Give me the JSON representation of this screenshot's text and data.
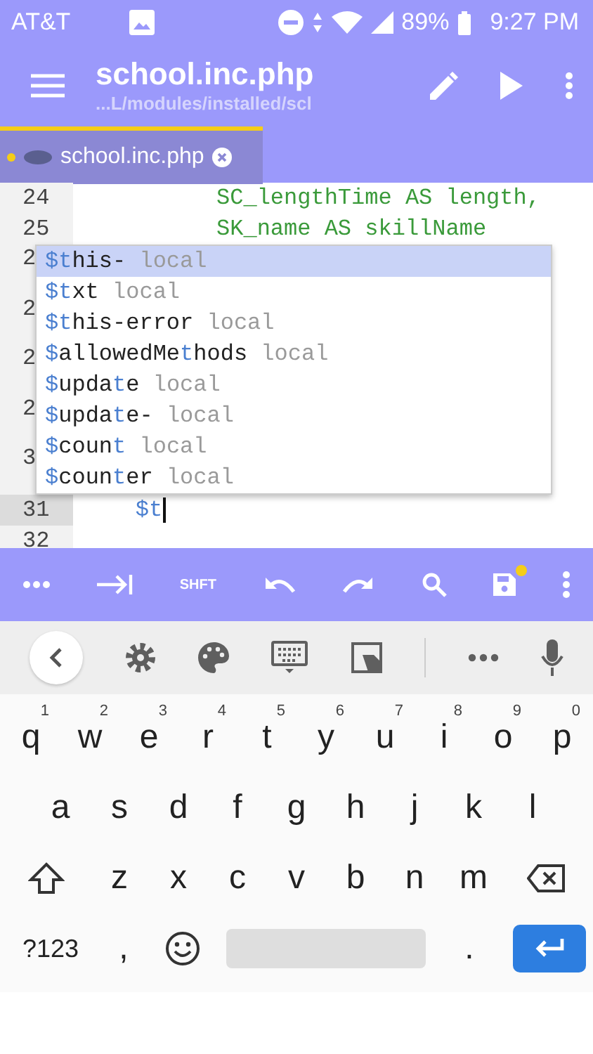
{
  "status_bar": {
    "carrier": "AT&T",
    "battery": "89%",
    "time": "9:27 PM"
  },
  "app_bar": {
    "title": "school.inc.php",
    "subtitle": "...L/modules/installed/scl"
  },
  "tabs": [
    {
      "label": "school.inc.php",
      "selected": true,
      "modified": true
    }
  ],
  "editor": {
    "lines": [
      {
        "kind": "line",
        "number": "24",
        "code": "          SC_lengthTime AS length,",
        "current": false
      },
      {
        "kind": "line",
        "number": "25",
        "code": "          SK_name AS skillName",
        "current": false
      },
      {
        "kind": "covered",
        "number": "2",
        "current": false
      },
      {
        "kind": "covered",
        "number": "2",
        "current": false
      },
      {
        "kind": "covered",
        "number": "2",
        "current": false
      },
      {
        "kind": "covered",
        "number": "2",
        "current": false
      },
      {
        "kind": "covered",
        "number": "3",
        "current": false
      },
      {
        "kind": "line",
        "number": "31",
        "code": "    $t",
        "current": true
      },
      {
        "kind": "line",
        "number": "32",
        "current": false
      }
    ],
    "completions": [
      {
        "selected": true,
        "parts": [
          {
            "text": "$t",
            "match": true
          },
          {
            "text": "his-",
            "match": false
          }
        ],
        "type": "local"
      },
      {
        "selected": false,
        "parts": [
          {
            "text": "$t",
            "match": true
          },
          {
            "text": "xt",
            "match": false
          }
        ],
        "type": "local"
      },
      {
        "selected": false,
        "parts": [
          {
            "text": "$t",
            "match": true
          },
          {
            "text": "his-error",
            "match": false
          }
        ],
        "type": "local"
      },
      {
        "selected": false,
        "parts": [
          {
            "text": "$",
            "match": true
          },
          {
            "text": "allowedMe",
            "match": false
          },
          {
            "text": "t",
            "match": true
          },
          {
            "text": "hods",
            "match": false
          }
        ],
        "type": "local"
      },
      {
        "selected": false,
        "parts": [
          {
            "text": "$",
            "match": true
          },
          {
            "text": "upda",
            "match": false
          },
          {
            "text": "t",
            "match": true
          },
          {
            "text": "e",
            "match": false
          }
        ],
        "type": "local"
      },
      {
        "selected": false,
        "parts": [
          {
            "text": "$",
            "match": true
          },
          {
            "text": "upda",
            "match": false
          },
          {
            "text": "t",
            "match": true
          },
          {
            "text": "e-",
            "match": false
          }
        ],
        "type": "local"
      },
      {
        "selected": false,
        "parts": [
          {
            "text": "$",
            "match": true
          },
          {
            "text": "coun",
            "match": false
          },
          {
            "text": "t",
            "match": true
          }
        ],
        "type": "local"
      },
      {
        "selected": false,
        "parts": [
          {
            "text": "$",
            "match": true
          },
          {
            "text": "coun",
            "match": false
          },
          {
            "text": "t",
            "match": true
          },
          {
            "text": "er",
            "match": false
          }
        ],
        "type": "local"
      }
    ]
  },
  "toolbar": {
    "shift_label": "SHFT",
    "unsaved": true
  },
  "keyboard": {
    "rows": [
      {
        "keys": [
          {
            "kind": "letter",
            "label": "q",
            "hint": "1"
          },
          {
            "kind": "letter",
            "label": "w",
            "hint": "2"
          },
          {
            "kind": "letter",
            "label": "e",
            "hint": "3"
          },
          {
            "kind": "letter",
            "label": "r",
            "hint": "4"
          },
          {
            "kind": "letter",
            "label": "t",
            "hint": "5"
          },
          {
            "kind": "letter",
            "label": "y",
            "hint": "6"
          },
          {
            "kind": "letter",
            "label": "u",
            "hint": "7"
          },
          {
            "kind": "letter",
            "label": "i",
            "hint": "8"
          },
          {
            "kind": "letter",
            "label": "o",
            "hint": "9"
          },
          {
            "kind": "letter",
            "label": "p",
            "hint": "0"
          }
        ]
      },
      {
        "keys": [
          {
            "kind": "letter",
            "label": "a"
          },
          {
            "kind": "letter",
            "label": "s"
          },
          {
            "kind": "letter",
            "label": "d"
          },
          {
            "kind": "letter",
            "label": "f"
          },
          {
            "kind": "letter",
            "label": "g"
          },
          {
            "kind": "letter",
            "label": "h"
          },
          {
            "kind": "letter",
            "label": "j"
          },
          {
            "kind": "letter",
            "label": "k"
          },
          {
            "kind": "letter",
            "label": "l"
          }
        ]
      },
      {
        "keys": [
          {
            "kind": "shift"
          },
          {
            "kind": "letter",
            "label": "z"
          },
          {
            "kind": "letter",
            "label": "x"
          },
          {
            "kind": "letter",
            "label": "c"
          },
          {
            "kind": "letter",
            "label": "v"
          },
          {
            "kind": "letter",
            "label": "b"
          },
          {
            "kind": "letter",
            "label": "n"
          },
          {
            "kind": "letter",
            "label": "m"
          },
          {
            "kind": "backspace"
          }
        ]
      },
      {
        "keys": [
          {
            "kind": "symbols",
            "label": "?123"
          },
          {
            "kind": "letter",
            "label": ","
          },
          {
            "kind": "emoji"
          },
          {
            "kind": "space"
          },
          {
            "kind": "letter",
            "label": "."
          },
          {
            "kind": "enter"
          }
        ]
      }
    ]
  }
}
